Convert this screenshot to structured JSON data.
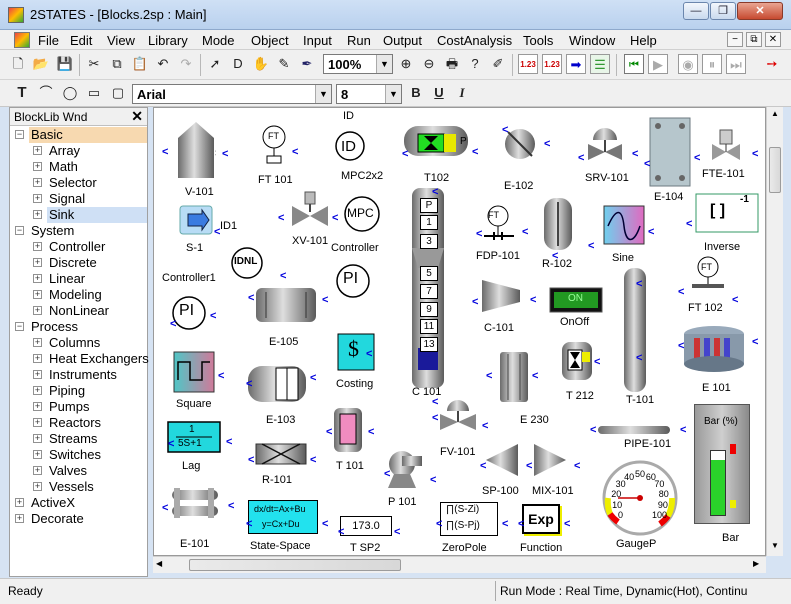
{
  "window": {
    "title": "2STATES - [Blocks.2sp : Main]"
  },
  "menu": [
    "File",
    "Edit",
    "View",
    "Library",
    "Mode",
    "Object",
    "Input",
    "Run",
    "Output",
    "CostAnalysis",
    "Tools",
    "Window",
    "Help"
  ],
  "toolbar": {
    "zoom": "100%"
  },
  "format": {
    "font": "Arial",
    "size": "8",
    "bold": "B",
    "underline": "U",
    "italic": "I"
  },
  "panel": {
    "title": "BlockLib Wnd",
    "tree": [
      {
        "label": "Basic",
        "level": 0,
        "sign": "−"
      },
      {
        "label": "Array",
        "level": 1,
        "sign": "+"
      },
      {
        "label": "Math",
        "level": 1,
        "sign": "+"
      },
      {
        "label": "Selector",
        "level": 1,
        "sign": "+"
      },
      {
        "label": "Signal",
        "level": 1,
        "sign": "+"
      },
      {
        "label": "Sink",
        "level": 1,
        "sign": "+"
      },
      {
        "label": "System",
        "level": 0,
        "sign": "−"
      },
      {
        "label": "Controller",
        "level": 1,
        "sign": "+"
      },
      {
        "label": "Discrete",
        "level": 1,
        "sign": "+"
      },
      {
        "label": "Linear",
        "level": 1,
        "sign": "+"
      },
      {
        "label": "Modeling",
        "level": 1,
        "sign": "+"
      },
      {
        "label": "NonLinear",
        "level": 1,
        "sign": "+"
      },
      {
        "label": "Process",
        "level": 0,
        "sign": "−"
      },
      {
        "label": "Columns",
        "level": 1,
        "sign": "+"
      },
      {
        "label": "Heat Exchangers",
        "level": 1,
        "sign": "+"
      },
      {
        "label": "Instruments",
        "level": 1,
        "sign": "+"
      },
      {
        "label": "Piping",
        "level": 1,
        "sign": "+"
      },
      {
        "label": "Pumps",
        "level": 1,
        "sign": "+"
      },
      {
        "label": "Reactors",
        "level": 1,
        "sign": "+"
      },
      {
        "label": "Streams",
        "level": 1,
        "sign": "+"
      },
      {
        "label": "Switches",
        "level": 1,
        "sign": "+"
      },
      {
        "label": "Valves",
        "level": 1,
        "sign": "+"
      },
      {
        "label": "Vessels",
        "level": 1,
        "sign": "+"
      },
      {
        "label": "ActiveX",
        "level": 0,
        "sign": "+"
      },
      {
        "label": "Decorate",
        "level": 0,
        "sign": "+"
      }
    ]
  },
  "blocks": {
    "v101": "V-101",
    "ft101": "FT 101",
    "ft_tag": "FT",
    "id_block": "ID",
    "id_top": "ID",
    "mpc2x2": "MPC2x2",
    "t102": "T102",
    "p_tag": "P",
    "e102": "E-102",
    "srv101": "SRV-101",
    "e104": "E-104",
    "fte101": "FTE-101",
    "s1": "S-1",
    "id1": "ID1",
    "xv101": "XV-101",
    "mpc": "MPC",
    "controller": "Controller",
    "fdp101": "FDP-101",
    "r102": "R-102",
    "sine": "Sine",
    "inverse": "Inverse",
    "inv_sym": "[ ]",
    "inv_sup": "-1",
    "controller1": "Controller1",
    "idnl": "IDNL",
    "pi": "PI",
    "c101": "C-101",
    "onoff": "OnOff",
    "on": "ON",
    "ft102": "FT 102",
    "e105": "E-105",
    "costing": "Costing",
    "dollar": "$",
    "square": "Square",
    "e103": "E-103",
    "c_col": "C 101",
    "e230": "E 230",
    "t212": "T 212",
    "t101": "T-101",
    "e101b": "E 101",
    "lag": "Lag",
    "lag_num": "1",
    "lag_den": "5S+1",
    "t101b": "T 101",
    "r101": "R-101",
    "fv101": "FV-101",
    "pipe101": "PIPE-101",
    "bar_pct": "Bar (%)",
    "bar": "Bar",
    "sp100": "SP-100",
    "mix101": "MIX-101",
    "p101": "P 101",
    "gaugep": "GaugeP",
    "e101": "E-101",
    "ss_1": "dx/dt=Ax+Bu",
    "ss_2": "y=Cx+Du",
    "state_space": "State-Space",
    "tsp2_val": "173.0",
    "tsp2": "T SP2",
    "zp1": "∏(S-Zi)",
    "zp2": "∏(S-Pj)",
    "zeropole": "ZeroPole",
    "exp": "Exp",
    "function": "Function",
    "col_nums": [
      "P",
      "1",
      "3",
      "5",
      "7",
      "9",
      "11",
      "13"
    ],
    "gauge_ticks": [
      "0",
      "10",
      "20",
      "30",
      "40",
      "50",
      "60",
      "70",
      "80",
      "90",
      "100"
    ]
  },
  "status": {
    "left": "Ready",
    "right": "Run Mode : Real Time, Dynamic(Hot), Continu"
  }
}
